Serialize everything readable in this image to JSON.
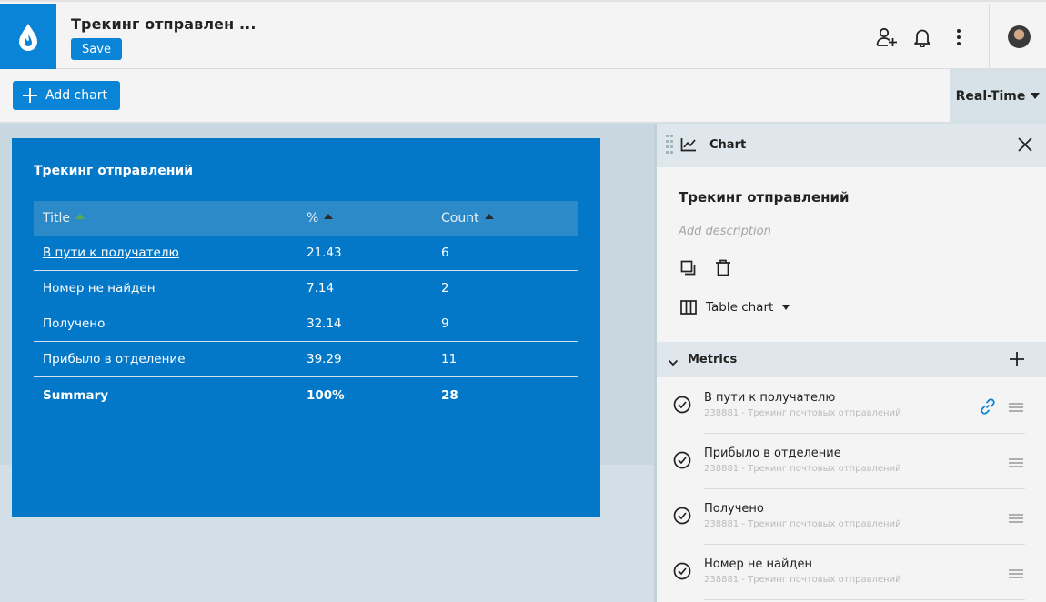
{
  "header": {
    "title": "Трекинг отправлен ...",
    "save_label": "Save",
    "icons": [
      "drop-logo-icon",
      "add-user-icon",
      "bell-icon",
      "more-vertical-icon",
      "avatar"
    ]
  },
  "toolbar": {
    "add_chart_label": "Add chart",
    "realtime_label": "Real-Time"
  },
  "card": {
    "title": "Трекинг отправлений",
    "columns": [
      "Title",
      "%",
      "Count"
    ],
    "rows": [
      {
        "title": "В пути к получателю",
        "percent": "21.43",
        "count": "6"
      },
      {
        "title": "Номер не найден",
        "percent": "7.14",
        "count": "2"
      },
      {
        "title": "Получено",
        "percent": "32.14",
        "count": "9"
      },
      {
        "title": "Прибыло в отделение",
        "percent": "39.29",
        "count": "11"
      }
    ],
    "summary": {
      "title": "Summary",
      "percent": "100%",
      "count": "28"
    },
    "colors": {
      "background": "#0378c8",
      "header": "#2b8ac7",
      "sort_active": "#5ba84c"
    }
  },
  "panel": {
    "head_title": "Chart",
    "chart_title": "Трекинг отправлений",
    "description_placeholder": "Add description",
    "chart_type": "Table chart",
    "metrics_label": "Metrics",
    "metrics": [
      {
        "name": "В пути к получателю",
        "source": "238881 - Трекинг почтовых отправлений"
      },
      {
        "name": "Прибыло в отделение",
        "source": "238881 - Трекинг почтовых отправлений"
      },
      {
        "name": "Получено",
        "source": "238881 - Трекинг почтовых отправлений"
      },
      {
        "name": "Номер не найден",
        "source": "238881 - Трекинг почтовых отправлений"
      }
    ]
  },
  "colors": {
    "accent": "#0a84d6"
  }
}
